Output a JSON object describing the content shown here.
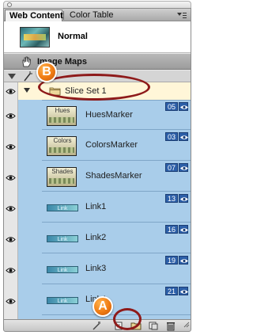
{
  "tabs": [
    {
      "label": "Web Content",
      "active": true
    },
    {
      "label": "Color Table",
      "active": false
    }
  ],
  "top_item": {
    "label": "Normal"
  },
  "section": {
    "label": "Image Maps"
  },
  "slice_set": {
    "label": "Slice Set 1"
  },
  "slices": [
    {
      "name": "HuesMarker",
      "badge": "05",
      "thumb_text": "Hues",
      "kind": "marker"
    },
    {
      "name": "ColorsMarker",
      "badge": "03",
      "thumb_text": "Colors",
      "kind": "marker"
    },
    {
      "name": "ShadesMarker",
      "badge": "07",
      "thumb_text": "Shades",
      "kind": "marker"
    },
    {
      "name": "Link1",
      "badge": "13",
      "thumb_text": "Link",
      "kind": "link"
    },
    {
      "name": "Link2",
      "badge": "16",
      "thumb_text": "Link",
      "kind": "link"
    },
    {
      "name": "Link3",
      "badge": "19",
      "thumb_text": "Link",
      "kind": "link"
    },
    {
      "name": "Link4",
      "badge": "21",
      "thumb_text": "Link",
      "kind": "link"
    }
  ],
  "callouts": {
    "a": "A",
    "b": "B"
  },
  "colors": {
    "list_background": "#a9cdea",
    "badge_blue": "#2c5fa8",
    "callout_orange": "#f07b12",
    "ring_red": "#8e1a1a",
    "slice_set_highlight": "#fff6d8"
  },
  "icons": [
    "hand-icon",
    "wand-icon",
    "eye-icon",
    "folder-icon",
    "panel-menu-icon",
    "new-folder-icon",
    "duplicate-icon",
    "trash-icon"
  ]
}
